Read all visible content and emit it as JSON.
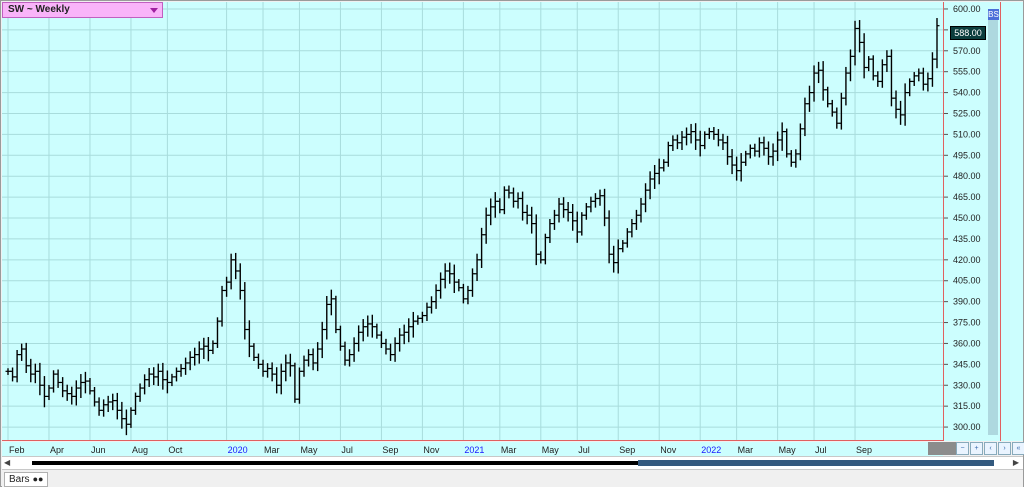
{
  "window": {
    "title": "SW ~ Weekly",
    "bottom_tab_label": "Bars",
    "nav_left_glyph": "◀",
    "nav_right_glyph": "▶",
    "bs_badge": "BS",
    "current_price_label": "588.00"
  },
  "colors": {
    "plot_bg": "#ccfefe",
    "grid": "#a8dcdc",
    "bar": "#000000",
    "axis_line": "#e06060",
    "title_bg": "#f9b4f9",
    "year_label": "#1a1aff"
  },
  "chart_data": {
    "type": "ohlc-bar",
    "ylim": [
      290,
      605
    ],
    "y_ticks": [
      "300.00",
      "315.00",
      "330.00",
      "345.00",
      "360.00",
      "375.00",
      "390.00",
      "405.00",
      "420.00",
      "435.00",
      "450.00",
      "465.00",
      "480.00",
      "495.00",
      "510.00",
      "525.00",
      "540.00",
      "555.00",
      "570.00",
      "585.00",
      "600.00"
    ],
    "x_tick_labels": [
      {
        "label": "Feb",
        "week": 0,
        "year": false
      },
      {
        "label": "Apr",
        "week": 9,
        "year": false
      },
      {
        "label": "Jun",
        "week": 18,
        "year": false
      },
      {
        "label": "Aug",
        "week": 27,
        "year": false
      },
      {
        "label": "Oct",
        "week": 35,
        "year": false
      },
      {
        "label": "2020",
        "week": 48,
        "year": true
      },
      {
        "label": "Mar",
        "week": 56,
        "year": false
      },
      {
        "label": "May",
        "week": 64,
        "year": false
      },
      {
        "label": "Jul",
        "week": 73,
        "year": false
      },
      {
        "label": "Sep",
        "week": 82,
        "year": false
      },
      {
        "label": "Nov",
        "week": 91,
        "year": false
      },
      {
        "label": "2021",
        "week": 100,
        "year": true
      },
      {
        "label": "Mar",
        "week": 108,
        "year": false
      },
      {
        "label": "May",
        "week": 117,
        "year": false
      },
      {
        "label": "Jul",
        "week": 125,
        "year": false
      },
      {
        "label": "Sep",
        "week": 134,
        "year": false
      },
      {
        "label": "Nov",
        "week": 143,
        "year": false
      },
      {
        "label": "2022",
        "week": 152,
        "year": true
      },
      {
        "label": "Mar",
        "week": 160,
        "year": false
      },
      {
        "label": "May",
        "week": 169,
        "year": false
      },
      {
        "label": "Jul",
        "week": 177,
        "year": false
      },
      {
        "label": "Sep",
        "week": 186,
        "year": false
      }
    ],
    "close": [
      340,
      336,
      352,
      356,
      344,
      338,
      340,
      330,
      322,
      328,
      338,
      332,
      326,
      324,
      322,
      328,
      332,
      333,
      326,
      318,
      312,
      316,
      318,
      319,
      312,
      306,
      302,
      312,
      322,
      328,
      334,
      338,
      336,
      340,
      334,
      332,
      336,
      340,
      342,
      346,
      350,
      352,
      356,
      358,
      355,
      360,
      376,
      398,
      404,
      420,
      412,
      398,
      370,
      358,
      350,
      345,
      340,
      342,
      338,
      330,
      340,
      346,
      344,
      320,
      340,
      348,
      352,
      346,
      356,
      370,
      388,
      392,
      370,
      358,
      348,
      352,
      360,
      368,
      372,
      374,
      372,
      366,
      360,
      356,
      352,
      360,
      366,
      368,
      372,
      376,
      378,
      380,
      386,
      390,
      398,
      406,
      412,
      410,
      404,
      400,
      392,
      398,
      410,
      420,
      438,
      452,
      458,
      462,
      456,
      470,
      468,
      462,
      464,
      454,
      452,
      446,
      424,
      420,
      436,
      446,
      452,
      460,
      456,
      454,
      448,
      440,
      452,
      458,
      462,
      464,
      466,
      450,
      424,
      418,
      428,
      432,
      440,
      446,
      452,
      460,
      470,
      478,
      482,
      486,
      490,
      502,
      506,
      504,
      508,
      510,
      512,
      506,
      502,
      510,
      512,
      510,
      506,
      504,
      494,
      488,
      484,
      490,
      496,
      500,
      498,
      504,
      500,
      494,
      498,
      506,
      512,
      496,
      490,
      496,
      514,
      532,
      540,
      554,
      556,
      542,
      532,
      526,
      518,
      536,
      554,
      566,
      586,
      576,
      558,
      564,
      552,
      548,
      560,
      566,
      536,
      528,
      524,
      540,
      548,
      552,
      554,
      546,
      550,
      564,
      588
    ]
  }
}
